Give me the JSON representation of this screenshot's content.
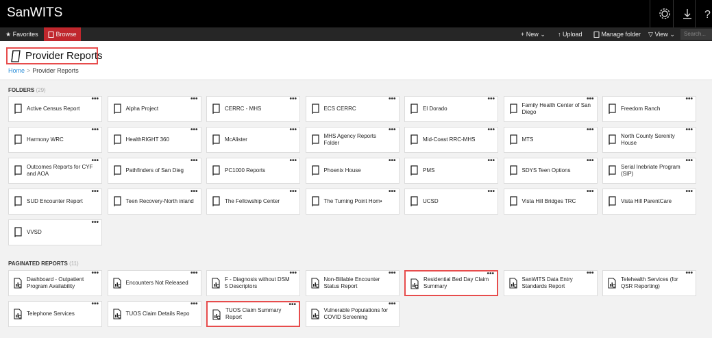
{
  "app": {
    "title": "SanWITS"
  },
  "nav": {
    "favorites": "Favorites",
    "browse": "Browse"
  },
  "toolbar": {
    "new": "New",
    "upload": "Upload",
    "manage_folder": "Manage folder",
    "view": "View",
    "search_placeholder": "Search..."
  },
  "page": {
    "title": "Provider Reports"
  },
  "breadcrumb": {
    "home": "Home",
    "current": "Provider Reports"
  },
  "folders": {
    "label": "FOLDERS",
    "count": "(29)",
    "items": [
      "Active Census Report",
      "Alpha Project",
      "CERRC - MHS",
      "ECS CERRC",
      "El Dorado",
      "Family Health Center of San Diego",
      "Freedom Ranch",
      "Harmony WRC",
      "HealthRIGHT 360",
      "McAlister",
      "MHS Agency Reports Folder",
      "Mid-Coast RRC-MHS",
      "MTS",
      "North County Serenity House",
      "Outcomes Reports for CYF and AOA",
      "Pathfinders of San Dieg",
      "PC1000 Reports",
      "Phoenix House",
      "PMS",
      "SDYS Teen Options",
      "Serial Inebriate Program (SIP)",
      "SUD Encounter Report",
      "Teen Recovery-North inland",
      "The Fellowship Center",
      "The Turning Point Hom•",
      "UCSD",
      "Vista Hill Bridges TRC",
      "Vista Hill ParentCare",
      "VVSD"
    ]
  },
  "reports": {
    "label": "PAGINATED REPORTS",
    "count": "(11)",
    "items": [
      "Dashboard - Outpatient Program Availability",
      "Encounters Not Released",
      "F - Diagnosis without DSM 5 Descriptors",
      "Non-Billable Encounter Status Report",
      "Residential Bed Day Claim Summary",
      "SanWITS Data Entry Standards Report",
      "Telehealth Services (for QSR Reporting)",
      "Telephone Services",
      "TUOS Claim Details Repo",
      "TUOS Claim Summary Report",
      "Vulnerable Populations for COVID Screening"
    ]
  },
  "colors": {
    "accent": "#c0272d",
    "highlight": "#e74c4c",
    "link": "#2a8dd8"
  },
  "icons": {
    "tile_menu": "ellipsis-icon",
    "folder": "folder-icon",
    "report": "report-icon"
  }
}
